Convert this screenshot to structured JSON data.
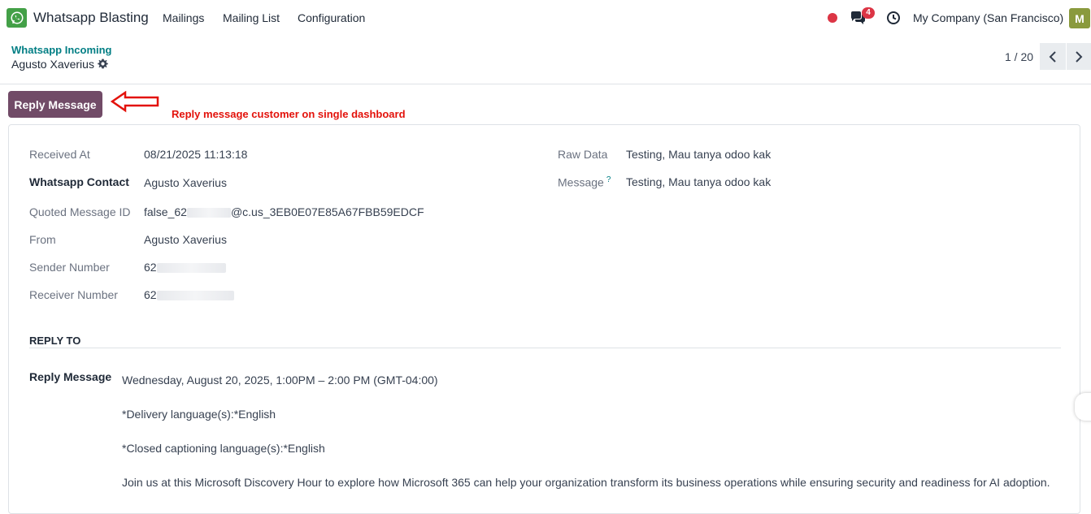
{
  "app": {
    "name": "Whatsapp Blasting",
    "menu": [
      "Mailings",
      "Mailing List",
      "Configuration"
    ],
    "chat_badge": "4",
    "company": "My Company (San Francisco)",
    "avatar_letter": "M",
    "colors": {
      "primary": "#714b67",
      "link": "#017e84",
      "annotation": "#e3120b",
      "whatsapp": "#43a047"
    }
  },
  "breadcrumb": {
    "parent": "Whatsapp Incoming",
    "current": "Agusto Xaverius"
  },
  "pager": {
    "value": "1 / 20"
  },
  "actions": {
    "reply_button": "Reply Message"
  },
  "annotation": {
    "text": "Reply message customer on single dashboard"
  },
  "fields": {
    "received_at": {
      "label": "Received At",
      "value": "08/21/2025 11:13:18"
    },
    "contact": {
      "label": "Whatsapp Contact",
      "value": "Agusto Xaverius"
    },
    "quoted_id": {
      "label": "Quoted Message ID",
      "prefix": "false_62",
      "suffix": "@c.us_3EB0E07E85A67FBB59EDCF"
    },
    "from": {
      "label": "From",
      "value": "Agusto Xaverius"
    },
    "sender_number": {
      "label": "Sender Number",
      "value": "62"
    },
    "receiver_number": {
      "label": "Receiver Number",
      "value": "62"
    },
    "raw_data": {
      "label": "Raw Data",
      "value": "Testing, Mau tanya odoo kak"
    },
    "message": {
      "label": "Message",
      "help": "?",
      "value": "Testing, Mau tanya odoo kak"
    }
  },
  "reply_to": {
    "section_title": "REPLY TO",
    "label": "Reply Message",
    "lines": [
      "Wednesday, August 20, 2025, 1:00PM – 2:00 PM (GMT-04:00)",
      "*Delivery language(s):*English",
      "*Closed captioning language(s):*English",
      "Join us at this Microsoft Discovery Hour to explore how Microsoft 365 can help your organization transform its business operations while ensuring security and readiness for AI adoption."
    ]
  }
}
